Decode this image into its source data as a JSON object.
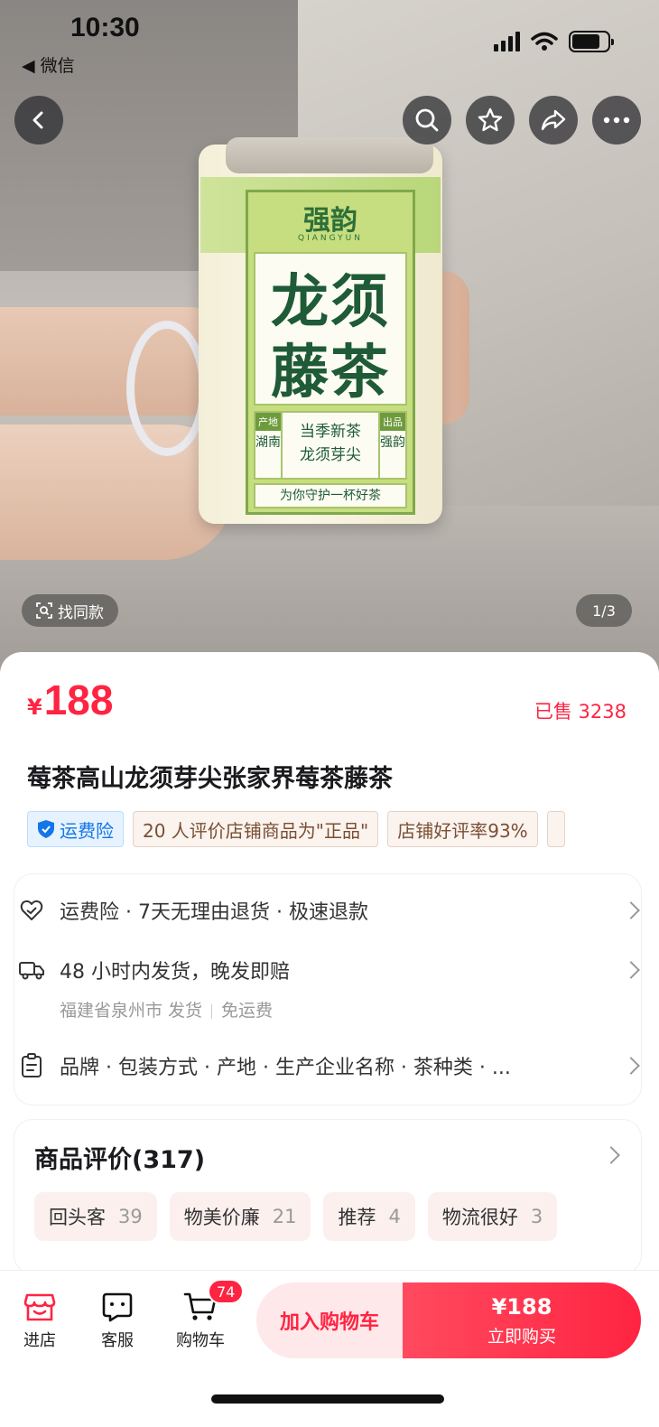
{
  "status_bar": {
    "time": "10:30",
    "back_app": "◀ 微信"
  },
  "product_image": {
    "brand_cn": "强韵",
    "brand_en": "QIANGYUN",
    "title_line1": "龙须",
    "title_line2": "藤茶",
    "origin_tag": "产地",
    "origin_value": "湖南",
    "mid_line1": "当季新茶",
    "mid_line2": "龙须芽尖",
    "producer_tag": "出品",
    "producer_value": "强韵",
    "slogan": "为你守护一杯好茶"
  },
  "image_overlay": {
    "find_similar": "找同款",
    "pager": "1/3"
  },
  "product": {
    "currency": "¥",
    "price": "188",
    "sold": "已售 3238",
    "title": "莓茶高山龙须芽尖张家界莓茶藤茶"
  },
  "tags": [
    {
      "label": "运费险"
    },
    {
      "label": "20 人评价店铺商品为\"正品\""
    },
    {
      "label": "店铺好评率93%"
    }
  ],
  "services": {
    "guarantee": "运费险 · 7天无理由退货 · 极速退款",
    "shipping": "48 小时内发货，晚发即赔",
    "shipping_from": "福建省泉州市 发货",
    "shipping_fee": "免运费",
    "params": "品牌 · 包装方式 · 产地 · 生产企业名称 · 茶种类 · ..."
  },
  "reviews": {
    "title": "商品评价(317)",
    "tags": [
      {
        "label": "回头客",
        "count": "39"
      },
      {
        "label": "物美价廉",
        "count": "21"
      },
      {
        "label": "推荐",
        "count": "4"
      },
      {
        "label": "物流很好",
        "count": "3"
      }
    ]
  },
  "bottom_bar": {
    "store": "进店",
    "service": "客服",
    "cart": "购物车",
    "cart_count": "74",
    "add_to_cart": "加入购物车",
    "buy_price": "¥188",
    "buy_now": "立即购买"
  },
  "colors": {
    "accent": "#ff2442",
    "blue_tag": "#1475e8",
    "brown_tag": "#7a4f34"
  }
}
